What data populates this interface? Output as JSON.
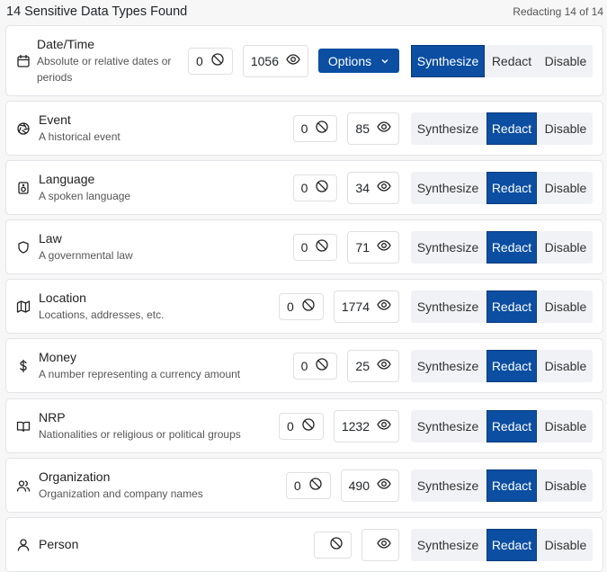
{
  "header": {
    "title": "14 Sensitive Data Types Found",
    "status": "Redacting 14 of 14"
  },
  "labels": {
    "synthesize": "Synthesize",
    "redact": "Redact",
    "disable": "Disable",
    "options": "Options"
  },
  "colors": {
    "accent": "#0b4ea2"
  },
  "items": [
    {
      "name": "Date/Time",
      "desc": "Absolute or relative dates or periods",
      "ignored": "0",
      "found": "1056",
      "mode": "Synthesize",
      "icon": "calendar-icon"
    },
    {
      "name": "Event",
      "desc": "A historical event",
      "ignored": "0",
      "found": "85",
      "mode": "Redact",
      "icon": "aperture-icon"
    },
    {
      "name": "Language",
      "desc": "A spoken language",
      "ignored": "0",
      "found": "34",
      "mode": "Redact",
      "icon": "speaker-icon"
    },
    {
      "name": "Law",
      "desc": "A governmental law",
      "ignored": "0",
      "found": "71",
      "mode": "Redact",
      "icon": "shield-icon"
    },
    {
      "name": "Location",
      "desc": "Locations, addresses, etc.",
      "ignored": "0",
      "found": "1774",
      "mode": "Redact",
      "icon": "map-icon"
    },
    {
      "name": "Money",
      "desc": "A number representing a currency amount",
      "ignored": "0",
      "found": "25",
      "mode": "Redact",
      "icon": "dollar-icon"
    },
    {
      "name": "NRP",
      "desc": "Nationalities or religious or political groups",
      "ignored": "0",
      "found": "1232",
      "mode": "Redact",
      "icon": "book-icon"
    },
    {
      "name": "Organization",
      "desc": "Organization and company names",
      "ignored": "0",
      "found": "490",
      "mode": "Redact",
      "icon": "users-icon"
    },
    {
      "name": "Person",
      "desc": "",
      "ignored": "",
      "found": "",
      "mode": "Redact",
      "icon": "user-icon"
    }
  ]
}
